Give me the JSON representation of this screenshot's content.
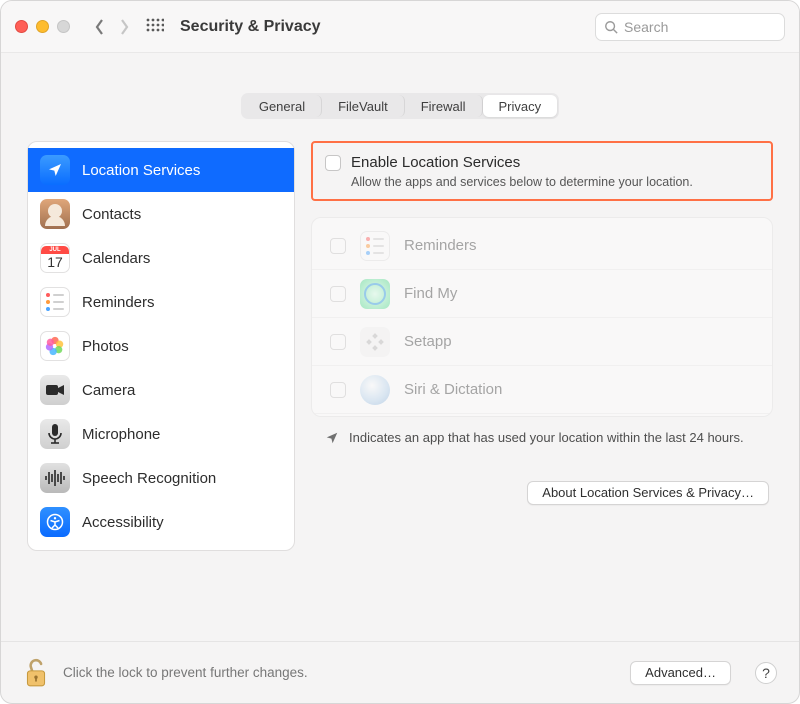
{
  "window": {
    "title": "Security & Privacy"
  },
  "search": {
    "placeholder": "Search"
  },
  "tabs": [
    "General",
    "FileVault",
    "Firewall",
    "Privacy"
  ],
  "tabs_active_index": 3,
  "sidebar": {
    "items": [
      {
        "label": "Location Services",
        "icon": "location-arrow",
        "selected": true
      },
      {
        "label": "Contacts",
        "icon": "contacts",
        "selected": false
      },
      {
        "label": "Calendars",
        "icon": "calendar",
        "selected": false
      },
      {
        "label": "Reminders",
        "icon": "reminders",
        "selected": false
      },
      {
        "label": "Photos",
        "icon": "photos",
        "selected": false
      },
      {
        "label": "Camera",
        "icon": "camera",
        "selected": false
      },
      {
        "label": "Microphone",
        "icon": "microphone",
        "selected": false
      },
      {
        "label": "Speech Recognition",
        "icon": "waveform",
        "selected": false
      },
      {
        "label": "Accessibility",
        "icon": "accessibility",
        "selected": false
      }
    ]
  },
  "calendar_icon": {
    "month": "JUL",
    "day": "17"
  },
  "enable": {
    "label": "Enable Location Services",
    "description": "Allow the apps and services below to determine your location.",
    "checked": false
  },
  "apps": [
    {
      "name": "Reminders",
      "checked": false,
      "icon": "reminders"
    },
    {
      "name": "Find My",
      "checked": false,
      "icon": "findmy"
    },
    {
      "name": "Setapp",
      "checked": false,
      "icon": "setapp"
    },
    {
      "name": "Siri & Dictation",
      "checked": false,
      "icon": "siri"
    }
  ],
  "hint": "Indicates an app that has used your location within the last 24 hours.",
  "about_button": "About Location Services & Privacy…",
  "footer": {
    "message": "Click the lock to prevent further changes.",
    "advanced": "Advanced…"
  }
}
